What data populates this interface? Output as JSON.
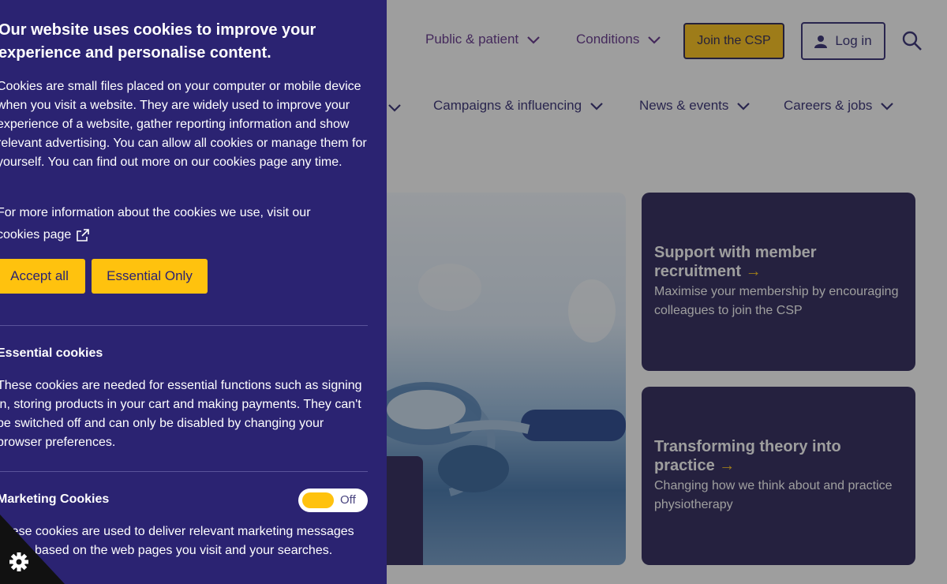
{
  "header": {
    "nav": [
      {
        "label": "Public & patient"
      },
      {
        "label": "Conditions"
      }
    ],
    "join_label": "Join the CSP",
    "login_label": "Log in"
  },
  "subnav": [
    {
      "label": "Campaigns & influencing"
    },
    {
      "label": "News & events"
    },
    {
      "label": "Careers & jobs"
    }
  ],
  "promos": [
    {
      "title": "Support with member recruitment",
      "description": "Maximise your membership by encouraging colleagues to join the CSP"
    },
    {
      "title": "Transforming theory into practice",
      "description": "Changing how we think about and practice physiotherapy"
    }
  ],
  "cookie_panel": {
    "heading": "Our website uses cookies to improve your experience and personalise content.",
    "intro": "Cookies are small files placed on your computer or mobile device when you visit a website. They are widely used to improve your experience of a website, gather reporting information and show relevant advertising. You can allow all cookies or manage them for yourself. You can find out more on our cookies page any time.",
    "more_info_prefix": "For more information about the cookies we use, visit our",
    "cookies_link": "cookies page",
    "accept_all": "Accept all",
    "essential_only": "Essential Only",
    "essential_title": "Essential cookies",
    "essential_desc": "These cookies are needed for essential functions such as signing in, storing products in your cart and making payments. They can't be switched off and can only be disabled by changing your browser preferences.",
    "marketing_title": "Marketing Cookies",
    "marketing_toggle": "Off",
    "marketing_desc": "These cookies are used to deliver relevant marketing messages to you based on the web pages you visit and your searches."
  },
  "colors": {
    "panel": "#2b2372",
    "accent": "#ffc20e",
    "nav_text": "#5b2a86",
    "card": "#231d52"
  }
}
